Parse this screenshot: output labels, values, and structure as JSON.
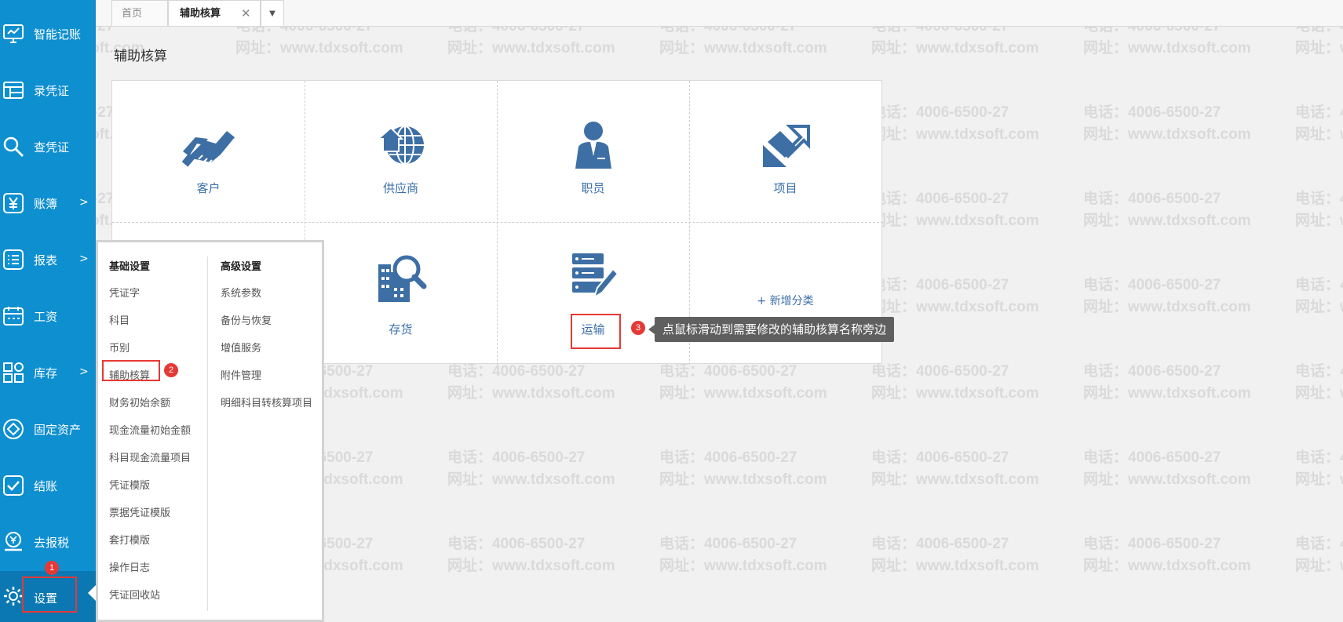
{
  "watermark": {
    "phone": "电话：4006-6500-27",
    "url": "网址：www.tdxsoft.com"
  },
  "sidebar": {
    "items": [
      {
        "label": "智能记账",
        "icon": "monitor-icon",
        "arrow": ""
      },
      {
        "label": "录凭证",
        "icon": "voucher-entry-icon",
        "arrow": ""
      },
      {
        "label": "查凭证",
        "icon": "search-icon",
        "arrow": ""
      },
      {
        "label": "账簿",
        "icon": "yen-icon",
        "arrow": ">"
      },
      {
        "label": "报表",
        "icon": "list-icon",
        "arrow": ">"
      },
      {
        "label": "工资",
        "icon": "calendar-icon",
        "arrow": ""
      },
      {
        "label": "库存",
        "icon": "grid-icon",
        "arrow": ">"
      },
      {
        "label": "固定资产",
        "icon": "asset-icon",
        "arrow": ""
      },
      {
        "label": "结账",
        "icon": "checkbox-icon",
        "arrow": ""
      },
      {
        "label": "去报税",
        "icon": "tax-icon",
        "arrow": ""
      },
      {
        "label": "设置",
        "icon": "gear-icon",
        "arrow": ""
      }
    ]
  },
  "tabs": {
    "home": "首页",
    "current": "辅助核算",
    "close": "✕",
    "more": "▼"
  },
  "page": {
    "title": "辅助核算",
    "categories": [
      {
        "label": "客户",
        "icon": "handshake-icon"
      },
      {
        "label": "供应商",
        "icon": "globe-house-icon"
      },
      {
        "label": "职员",
        "icon": "person-icon"
      },
      {
        "label": "项目",
        "icon": "project-arrow-icon"
      },
      {
        "label": "",
        "icon": ""
      },
      {
        "label": "存货",
        "icon": "inventory-search-icon"
      },
      {
        "label": "运输",
        "icon": "transport-icon"
      }
    ],
    "add_category": "+ 新增分类"
  },
  "tooltip": "点鼠标滑动到需要修改的辅助核算名称旁边",
  "steps": {
    "one": "1",
    "two": "2",
    "three": "3"
  },
  "settings_menu": {
    "basic": {
      "title": "基础设置",
      "items": [
        "凭证字",
        "科目",
        "币别",
        "辅助核算",
        "财务初始余额",
        "现金流量初始金额",
        "科目现金流量项目",
        "凭证模版",
        "票据凭证模版",
        "套打模版",
        "操作日志",
        "凭证回收站"
      ]
    },
    "advanced": {
      "title": "高级设置",
      "items": [
        "系统参数",
        "备份与恢复",
        "增值服务",
        "附件管理",
        "明细科目转核算项目"
      ]
    }
  },
  "colors": {
    "sidebar": "#0e8fd0",
    "highlight": "#e53935",
    "label": "#3b6fa8",
    "icon": "#3d6fa5"
  }
}
